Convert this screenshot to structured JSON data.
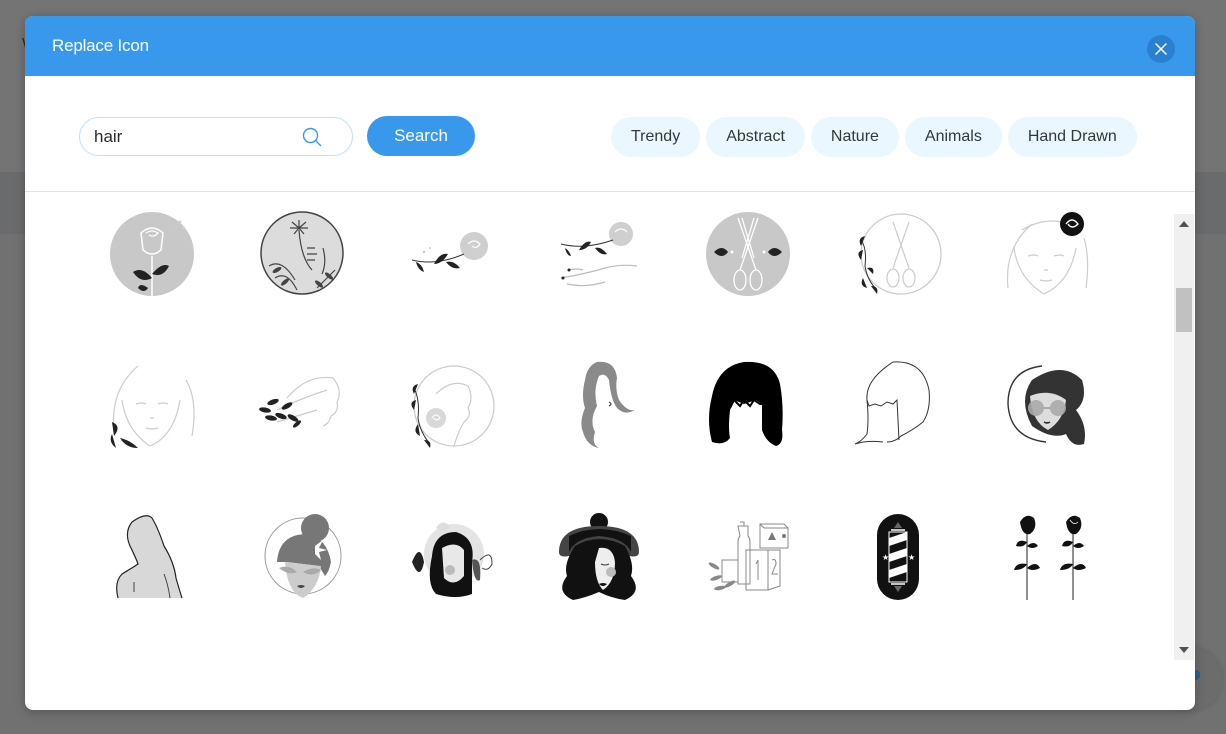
{
  "modal": {
    "title": "Replace Icon",
    "close_label": "close",
    "accent": "#3899ec"
  },
  "search": {
    "value": "hair",
    "placeholder": "",
    "button_label": "Search"
  },
  "categories": [
    "Trendy",
    "Abstract",
    "Nature",
    "Animals",
    "Hand Drawn"
  ],
  "icons": [
    {
      "name": "rose-in-grey-circle-icon"
    },
    {
      "name": "floral-wreath-circle-icon"
    },
    {
      "name": "rose-branch-icon"
    },
    {
      "name": "hand-holding-rose-icon"
    },
    {
      "name": "scissors-grey-circle-icon"
    },
    {
      "name": "scissors-leaf-circle-icon"
    },
    {
      "name": "woman-face-rose-icon"
    },
    {
      "name": "woman-face-leaves-icon"
    },
    {
      "name": "woman-profile-leaf-hair-icon"
    },
    {
      "name": "woman-profile-rose-circle-icon"
    },
    {
      "name": "long-wavy-hair-icon"
    },
    {
      "name": "black-bob-hair-icon"
    },
    {
      "name": "outline-bob-hair-icon"
    },
    {
      "name": "woman-sunglasses-circle-icon"
    },
    {
      "name": "woman-back-long-hair-icon"
    },
    {
      "name": "woman-bun-sunglasses-icon"
    },
    {
      "name": "woman-tropical-leaves-icon"
    },
    {
      "name": "woman-hat-icon"
    },
    {
      "name": "cosmetics-boxes-icon"
    },
    {
      "name": "barber-pole-icon"
    },
    {
      "name": "two-roses-icon"
    }
  ],
  "scrollbar": {
    "position_fraction": 0.15
  }
}
